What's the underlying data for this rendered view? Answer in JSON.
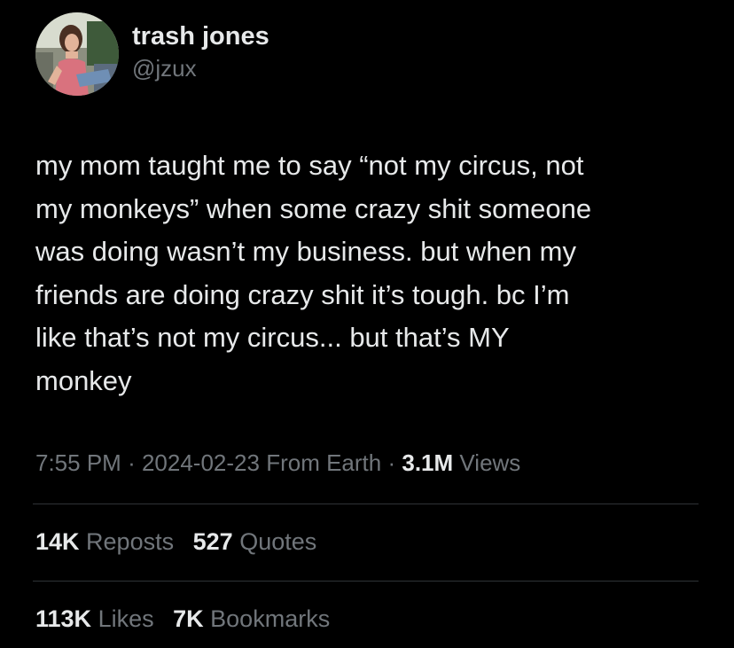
{
  "user": {
    "display_name": "trash jones",
    "handle": "@jzux",
    "avatar_icon": "profile-photo"
  },
  "tweet": {
    "text": "my mom taught me to say “not my circus, not\nmy monkeys” when some crazy shit someone\nwas doing wasn’t my business. but when my\nfriends are doing crazy shit it’s tough. bc I’m\nlike that’s not my circus... but that’s MY\nmonkey"
  },
  "meta": {
    "time": "7:55 PM",
    "separator": "·",
    "date": "2024-02-23",
    "source": "From Earth",
    "views_count": "3.1M",
    "views_label": "Views"
  },
  "stats_row1": [
    {
      "count": "14K",
      "label": "Reposts"
    },
    {
      "count": "527",
      "label": "Quotes"
    }
  ],
  "stats_row2": [
    {
      "count": "113K",
      "label": "Likes"
    },
    {
      "count": "7K",
      "label": "Bookmarks"
    }
  ],
  "colors": {
    "background": "#000000",
    "primary_text": "#e7e9ea",
    "secondary_text": "#71767b",
    "divider": "#2f3336"
  }
}
